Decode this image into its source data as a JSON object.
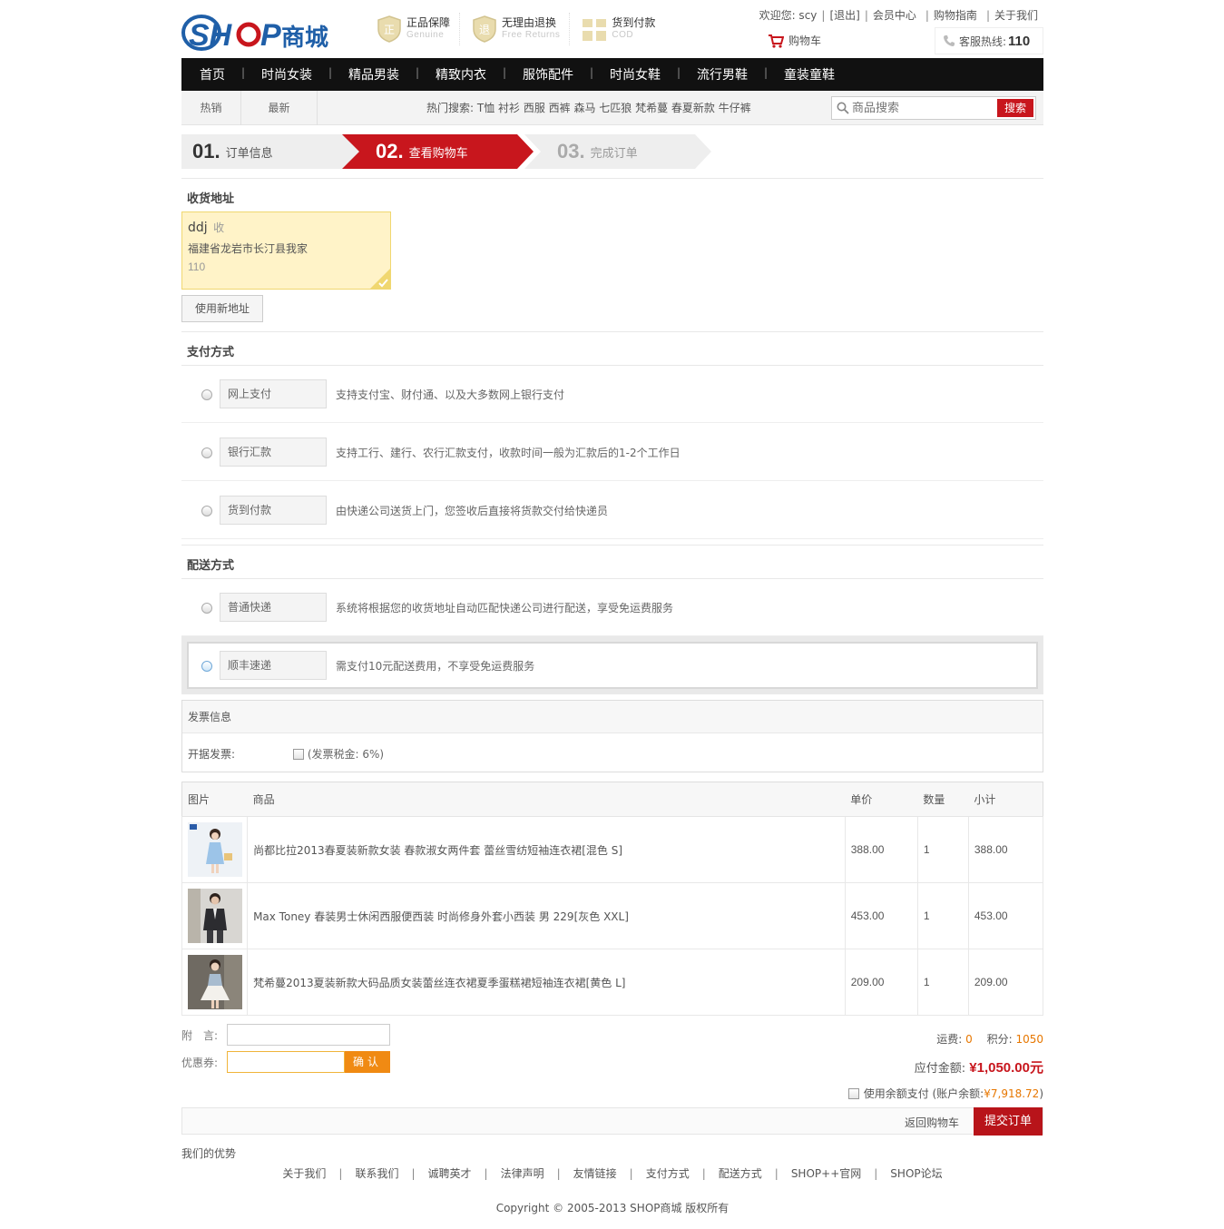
{
  "header": {
    "logo_text": "SHOP商城",
    "promises": [
      {
        "title": "正品保障",
        "sub": "Genuine",
        "icon": "genuine-shield-icon",
        "mark": "正"
      },
      {
        "title": "无理由退换",
        "sub": "Free Returns",
        "icon": "returns-shield-icon",
        "mark": "退"
      },
      {
        "title": "货到付款",
        "sub": "COD",
        "icon": "cod-box-icon"
      }
    ],
    "welcome": "欢迎您: scy",
    "logout": "[退出]",
    "member_center": "会员中心",
    "guide": "购物指南",
    "about": "关于我们",
    "cart": "购物车",
    "hotline_label": "客服热线:",
    "hotline_number": "110"
  },
  "nav": {
    "items": [
      "首页",
      "时尚女装",
      "精品男装",
      "精致内衣",
      "服饰配件",
      "时尚女鞋",
      "流行男鞋",
      "童装童鞋"
    ]
  },
  "subbar": {
    "tabs": [
      "热销",
      "最新"
    ],
    "hot_keywords": "热门搜索: T恤 衬衫 西服 西裤 森马 七匹狼 梵希蔓 春夏新款 牛仔裤",
    "search_placeholder": "商品搜索",
    "search_button": "搜索"
  },
  "steps": [
    {
      "num": "01.",
      "label": "订单信息"
    },
    {
      "num": "02.",
      "label": "查看购物车"
    },
    {
      "num": "03.",
      "label": "完成订单"
    }
  ],
  "address": {
    "section_title": "收货地址",
    "name": "ddj",
    "receive": "收",
    "detail": "福建省龙岩市长汀县我家",
    "phone": "110",
    "new_address_button": "使用新地址"
  },
  "payment": {
    "section_title": "支付方式",
    "options": [
      {
        "label": "网上支付",
        "desc": "支持支付宝、财付通、以及大多数网上银行支付"
      },
      {
        "label": "银行汇款",
        "desc": "支持工行、建行、农行汇款支付，收款时间一般为汇款后的1-2个工作日"
      },
      {
        "label": "货到付款",
        "desc": "由快递公司送货上门，您签收后直接将货款交付给快递员"
      }
    ]
  },
  "shipping": {
    "section_title": "配送方式",
    "options": [
      {
        "label": "普通快递",
        "desc": "系统将根据您的收货地址自动匹配快递公司进行配送，享受免运费服务"
      },
      {
        "label": "顺丰速递",
        "desc": "需支付10元配送费用，不享受免运费服务",
        "selected": true
      }
    ]
  },
  "invoice": {
    "title": "发票信息",
    "label": "开据发票:",
    "checkbox_text": "(发票税金: 6%)"
  },
  "products": {
    "headers": [
      "图片",
      "商品",
      "单价",
      "数量",
      "小计"
    ],
    "rows": [
      {
        "name": "尚都比拉2013春夏装新款女装 春款淑女两件套 蕾丝雪纺短袖连衣裙[混色 S]",
        "price": "388.00",
        "qty": "1",
        "subtotal": "388.00",
        "thumb": "blue-dress-thumbnail"
      },
      {
        "name": "Max Toney 春装男士休闲西服便西装 时尚修身外套小西装 男 229[灰色 XXL]",
        "price": "453.00",
        "qty": "1",
        "subtotal": "453.00",
        "thumb": "men-blazer-thumbnail"
      },
      {
        "name": "梵希蔓2013夏装新款大码品质女装蕾丝连衣裙夏季蛋糕裙短袖连衣裙[黄色 L]",
        "price": "209.00",
        "qty": "1",
        "subtotal": "209.00",
        "thumb": "lace-dress-thumbnail"
      }
    ]
  },
  "summary": {
    "message_label": "附　言:",
    "coupon_label": "优惠券:",
    "coupon_button": "确认",
    "shipping_label": "运费:",
    "shipping_value": "0",
    "points_label": "积分:",
    "points_value": "1050",
    "payable_label": "应付金额:",
    "payable_value": "¥1,050.00元",
    "balance_text": "使用余额支付 (账户余额:",
    "balance_value": "¥7,918.72",
    "balance_close": ")",
    "back_to_cart": "返回购物车",
    "submit": "提交订单"
  },
  "footer": {
    "advantage": "我们的优势",
    "links": [
      "关于我们",
      "联系我们",
      "诚聘英才",
      "法律声明",
      "友情链接",
      "支付方式",
      "配送方式",
      "SHOP++官网",
      "SHOP论坛"
    ],
    "copyright": "Copyright © 2005-2013 SHOP商城 版权所有"
  },
  "colors": {
    "brand_blue": "#1f5fa8",
    "brand_red": "#c8161d",
    "nav_bg": "#111111",
    "accent_orange": "#f08a13"
  }
}
